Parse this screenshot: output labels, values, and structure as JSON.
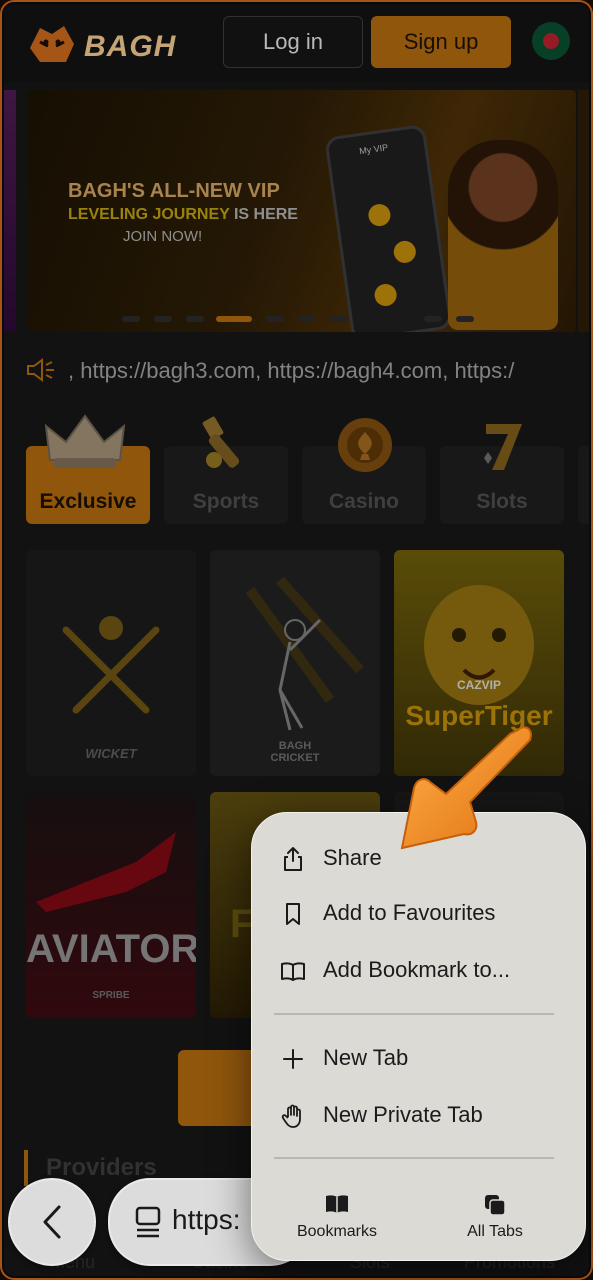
{
  "header": {
    "logo_text": "BAGH",
    "login_label": "Log in",
    "signup_label": "Sign up"
  },
  "banner": {
    "line1": "BAGH'S ALL-NEW VIP",
    "line2_a": "LEVELING JOURNEY",
    "line2_b": " IS HERE",
    "line3": "JOIN NOW!",
    "phone_label": "My VIP"
  },
  "marquee": {
    "text": ", https://bagh3.com, https://bagh4.com, https:/"
  },
  "categories": [
    {
      "label": "Exclusive"
    },
    {
      "label": "Sports"
    },
    {
      "label": "Casino"
    },
    {
      "label": "Slots"
    }
  ],
  "games": {
    "wicket": "WICKET",
    "bagh_cricket_1": "BAGH",
    "bagh_cricket_2": "CRICKET",
    "superhero_brand": "CAZVIP",
    "superhero_title": "SuperTiger",
    "aviator": "AVIATOR",
    "aviator_brand": "SPRIBE",
    "fortune_letter": "F"
  },
  "providers_title": "Providers",
  "bottom_nav": [
    "Menu",
    "Casino",
    "Slots",
    "Promotions"
  ],
  "safari": {
    "url_text": "https:"
  },
  "menu": {
    "items": [
      {
        "label": "Share",
        "icon": "share-icon"
      },
      {
        "label": "Add to Favourites",
        "icon": "bookmark-icon"
      },
      {
        "label": "Add Bookmark to...",
        "icon": "book-open-icon"
      },
      {
        "label": "New Tab",
        "icon": "plus-icon"
      },
      {
        "label": "New Private Tab",
        "icon": "hand-icon"
      }
    ],
    "bottom": [
      {
        "label": "Bookmarks",
        "icon": "book-icon"
      },
      {
        "label": "All Tabs",
        "icon": "tabs-icon"
      }
    ]
  },
  "colors": {
    "accent": "#a8650f",
    "menu_bg": "#dcdad5",
    "page_bg": "#161616",
    "arrow": "#f08a1c"
  }
}
